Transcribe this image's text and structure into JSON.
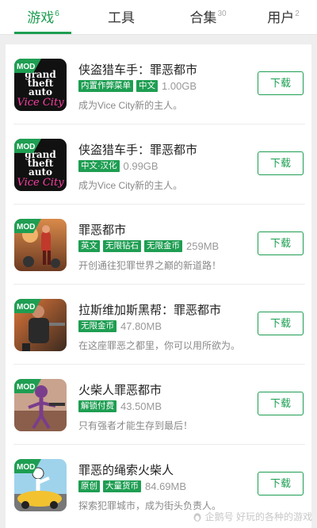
{
  "tabs": [
    {
      "label": "游戏",
      "badge": "6",
      "active": true
    },
    {
      "label": "工具",
      "badge": "",
      "active": false
    },
    {
      "label": "合集",
      "badge": "30",
      "active": false
    },
    {
      "label": "用户",
      "badge": "2",
      "active": false
    }
  ],
  "apps": [
    {
      "title": "侠盗猎车手：罪恶都市",
      "tags": [
        "内置作弊菜单",
        "中文"
      ],
      "size": "1.00GB",
      "desc": "成为Vice City新的主人。",
      "mod": "MOD",
      "button": "下载",
      "icon": "gta-vice-city-icon"
    },
    {
      "title": "侠盗猎车手：罪恶都市",
      "tags": [
        "中文·汉化"
      ],
      "size": "0.99GB",
      "desc": "成为Vice City新的主人。",
      "mod": "MOD",
      "button": "下载",
      "icon": "gta-vice-city-icon"
    },
    {
      "title": "罪恶都市",
      "tags": [
        "英文",
        "无限钻石",
        "无限金币"
      ],
      "size": "259MB",
      "desc": "开创通往犯罪世界之巅的新道路！",
      "mod": "MOD",
      "button": "下载",
      "icon": "crime-city-icon"
    },
    {
      "title": "拉斯维加斯黑帮：罪恶都市",
      "tags": [
        "无限金币"
      ],
      "size": "47.80MB",
      "desc": "在这座罪恶之都里，你可以用所欲为。",
      "mod": "MOD",
      "button": "下载",
      "icon": "vegas-gangster-icon"
    },
    {
      "title": "火柴人罪恶都市",
      "tags": [
        "解锁付费"
      ],
      "size": "43.50MB",
      "desc": "只有强者才能生存到最后！",
      "mod": "MOD",
      "button": "下载",
      "icon": "stickman-crime-icon"
    },
    {
      "title": "罪恶的绳索火柴人",
      "tags": [
        "原创",
        "大量货币"
      ],
      "size": "84.69MB",
      "desc": "探索犯罪城市，成为街头负责人。",
      "mod": "MOD",
      "button": "下载",
      "icon": "rope-stickman-icon"
    }
  ],
  "watermark": "企鹅号 好玩的各种的游戏",
  "colors": {
    "accent": "#1e9e52",
    "background": "#eeeeee"
  }
}
